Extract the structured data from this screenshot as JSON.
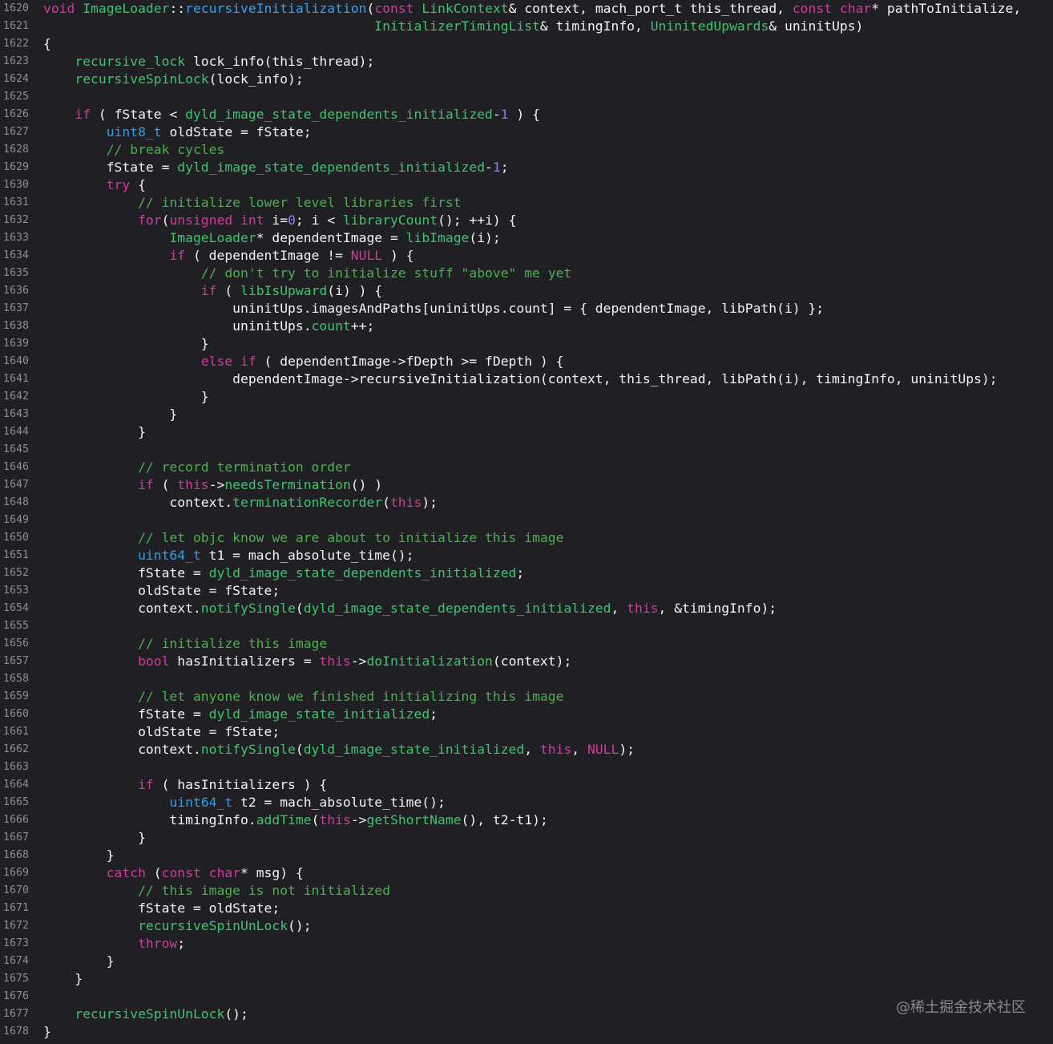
{
  "syntax_colors": {
    "background": "#1f1f24",
    "plain": "#f4f4f4",
    "line_number": "#8d8d93",
    "keyword": "#d3399e",
    "comment": "#49b24a",
    "symbol": "#3fc46e",
    "type": "#2a9ff0",
    "decl": "#35a3ee",
    "number": "#8b80f9",
    "watermark": "#8a8a8a"
  },
  "editor": {
    "lines": [
      {
        "n": 1620,
        "tokens": [
          [
            "keyword",
            "void"
          ],
          " ",
          [
            "symbol",
            "ImageLoader"
          ],
          "::",
          [
            "decl",
            "recursiveInitialization"
          ],
          "(",
          [
            "keyword",
            "const"
          ],
          " ",
          [
            "symbol",
            "LinkContext"
          ],
          "& context, mach_port_t this_thread, ",
          [
            "keyword",
            "const"
          ],
          " ",
          [
            "keyword",
            "char"
          ],
          "* pathToInitialize,"
        ]
      },
      {
        "n": 1621,
        "tokens": [
          "                                          ",
          [
            "symbol",
            "InitializerTimingList"
          ],
          "& timingInfo, ",
          [
            "symbol",
            "UninitedUpwards"
          ],
          "& uninitUps)"
        ]
      },
      {
        "n": 1622,
        "tokens": [
          "{"
        ]
      },
      {
        "n": 1623,
        "tokens": [
          "    ",
          [
            "symbol",
            "recursive_lock"
          ],
          " lock_info(this_thread);"
        ]
      },
      {
        "n": 1624,
        "tokens": [
          "    ",
          [
            "symbol",
            "recursiveSpinLock"
          ],
          "(lock_info);"
        ]
      },
      {
        "n": 1625,
        "tokens": []
      },
      {
        "n": 1626,
        "tokens": [
          "    ",
          [
            "keyword",
            "if"
          ],
          " ( fState < ",
          [
            "symbol",
            "dyld_image_state_dependents_initialized"
          ],
          "-",
          [
            "number",
            "1"
          ],
          " ) {"
        ]
      },
      {
        "n": 1627,
        "tokens": [
          "        ",
          [
            "type",
            "uint8_t"
          ],
          " oldState = fState;"
        ]
      },
      {
        "n": 1628,
        "tokens": [
          "        ",
          [
            "comment",
            "// break cycles"
          ]
        ]
      },
      {
        "n": 1629,
        "tokens": [
          "        fState = ",
          [
            "symbol",
            "dyld_image_state_dependents_initialized"
          ],
          "-",
          [
            "number",
            "1"
          ],
          ";"
        ]
      },
      {
        "n": 1630,
        "tokens": [
          "        ",
          [
            "keyword",
            "try"
          ],
          " {"
        ]
      },
      {
        "n": 1631,
        "tokens": [
          "            ",
          [
            "comment",
            "// initialize lower level libraries first"
          ]
        ]
      },
      {
        "n": 1632,
        "tokens": [
          "            ",
          [
            "keyword",
            "for"
          ],
          "(",
          [
            "keyword",
            "unsigned"
          ],
          " ",
          [
            "keyword",
            "int"
          ],
          " i=",
          [
            "number",
            "0"
          ],
          "; i < ",
          [
            "symbol",
            "libraryCount"
          ],
          "(); ++i) {"
        ]
      },
      {
        "n": 1633,
        "tokens": [
          "                ",
          [
            "symbol",
            "ImageLoader"
          ],
          "* dependentImage = ",
          [
            "symbol",
            "libImage"
          ],
          "(i);"
        ]
      },
      {
        "n": 1634,
        "tokens": [
          "                ",
          [
            "keyword",
            "if"
          ],
          " ( dependentImage != ",
          [
            "keyword",
            "NULL"
          ],
          " ) {"
        ]
      },
      {
        "n": 1635,
        "tokens": [
          "                    ",
          [
            "comment",
            "// don't try to initialize stuff \"above\" me yet"
          ]
        ]
      },
      {
        "n": 1636,
        "tokens": [
          "                    ",
          [
            "keyword",
            "if"
          ],
          " ( ",
          [
            "symbol",
            "libIsUpward"
          ],
          "(i) ) {"
        ]
      },
      {
        "n": 1637,
        "tokens": [
          "                        uninitUps.imagesAndPaths[uninitUps.count] = { dependentImage, libPath(i) };"
        ]
      },
      {
        "n": 1638,
        "tokens": [
          "                        uninitUps.",
          [
            "symbol",
            "count"
          ],
          "++;"
        ]
      },
      {
        "n": 1639,
        "tokens": [
          "                    }"
        ]
      },
      {
        "n": 1640,
        "tokens": [
          "                    ",
          [
            "keyword",
            "else"
          ],
          " ",
          [
            "keyword",
            "if"
          ],
          " ( dependentImage->fDepth >= fDepth ) {"
        ]
      },
      {
        "n": 1641,
        "tokens": [
          "                        dependentImage->recursiveInitialization(context, this_thread, libPath(i), timingInfo, uninitUps);"
        ]
      },
      {
        "n": 1642,
        "tokens": [
          "                    }"
        ]
      },
      {
        "n": 1643,
        "tokens": [
          "                }"
        ]
      },
      {
        "n": 1644,
        "tokens": [
          "            }"
        ]
      },
      {
        "n": 1645,
        "tokens": []
      },
      {
        "n": 1646,
        "tokens": [
          "            ",
          [
            "comment",
            "// record termination order"
          ]
        ]
      },
      {
        "n": 1647,
        "tokens": [
          "            ",
          [
            "keyword",
            "if"
          ],
          " ( ",
          [
            "keyword",
            "this"
          ],
          "->",
          [
            "symbol",
            "needsTermination"
          ],
          "() )"
        ]
      },
      {
        "n": 1648,
        "tokens": [
          "                context.",
          [
            "symbol",
            "terminationRecorder"
          ],
          "(",
          [
            "keyword",
            "this"
          ],
          ");"
        ]
      },
      {
        "n": 1649,
        "tokens": []
      },
      {
        "n": 1650,
        "tokens": [
          "            ",
          [
            "comment",
            "// let objc know we are about to initialize this image"
          ]
        ]
      },
      {
        "n": 1651,
        "tokens": [
          "            ",
          [
            "type",
            "uint64_t"
          ],
          " t1 = mach_absolute_time();"
        ]
      },
      {
        "n": 1652,
        "tokens": [
          "            fState = ",
          [
            "symbol",
            "dyld_image_state_dependents_initialized"
          ],
          ";"
        ]
      },
      {
        "n": 1653,
        "tokens": [
          "            oldState = fState;"
        ]
      },
      {
        "n": 1654,
        "tokens": [
          "            context.",
          [
            "symbol",
            "notifySingle"
          ],
          "(",
          [
            "symbol",
            "dyld_image_state_dependents_initialized"
          ],
          ", ",
          [
            "keyword",
            "this"
          ],
          ", &timingInfo);"
        ]
      },
      {
        "n": 1655,
        "tokens": []
      },
      {
        "n": 1656,
        "tokens": [
          "            ",
          [
            "comment",
            "// initialize this image"
          ]
        ]
      },
      {
        "n": 1657,
        "tokens": [
          "            ",
          [
            "keyword",
            "bool"
          ],
          " hasInitializers = ",
          [
            "keyword",
            "this"
          ],
          "->",
          [
            "symbol",
            "doInitialization"
          ],
          "(context);"
        ]
      },
      {
        "n": 1658,
        "tokens": []
      },
      {
        "n": 1659,
        "tokens": [
          "            ",
          [
            "comment",
            "// let anyone know we finished initializing this image"
          ]
        ]
      },
      {
        "n": 1660,
        "tokens": [
          "            fState = ",
          [
            "symbol",
            "dyld_image_state_initialized"
          ],
          ";"
        ]
      },
      {
        "n": 1661,
        "tokens": [
          "            oldState = fState;"
        ]
      },
      {
        "n": 1662,
        "tokens": [
          "            context.",
          [
            "symbol",
            "notifySingle"
          ],
          "(",
          [
            "symbol",
            "dyld_image_state_initialized"
          ],
          ", ",
          [
            "keyword",
            "this"
          ],
          ", ",
          [
            "keyword",
            "NULL"
          ],
          ");"
        ]
      },
      {
        "n": 1663,
        "tokens": []
      },
      {
        "n": 1664,
        "tokens": [
          "            ",
          [
            "keyword",
            "if"
          ],
          " ( hasInitializers ) {"
        ]
      },
      {
        "n": 1665,
        "tokens": [
          "                ",
          [
            "type",
            "uint64_t"
          ],
          " t2 = mach_absolute_time();"
        ]
      },
      {
        "n": 1666,
        "tokens": [
          "                timingInfo.",
          [
            "symbol",
            "addTime"
          ],
          "(",
          [
            "keyword",
            "this"
          ],
          "->",
          [
            "symbol",
            "getShortName"
          ],
          "(), t2-t1);"
        ]
      },
      {
        "n": 1667,
        "tokens": [
          "            }"
        ]
      },
      {
        "n": 1668,
        "tokens": [
          "        }"
        ]
      },
      {
        "n": 1669,
        "tokens": [
          "        ",
          [
            "keyword",
            "catch"
          ],
          " (",
          [
            "keyword",
            "const"
          ],
          " ",
          [
            "keyword",
            "char"
          ],
          "* msg) {"
        ]
      },
      {
        "n": 1670,
        "tokens": [
          "            ",
          [
            "comment",
            "// this image is not initialized"
          ]
        ]
      },
      {
        "n": 1671,
        "tokens": [
          "            fState = oldState;"
        ]
      },
      {
        "n": 1672,
        "tokens": [
          "            ",
          [
            "symbol",
            "recursiveSpinUnLock"
          ],
          "();"
        ]
      },
      {
        "n": 1673,
        "tokens": [
          "            ",
          [
            "keyword",
            "throw"
          ],
          ";"
        ]
      },
      {
        "n": 1674,
        "tokens": [
          "        }"
        ]
      },
      {
        "n": 1675,
        "tokens": [
          "    }"
        ]
      },
      {
        "n": 1676,
        "tokens": []
      },
      {
        "n": 1677,
        "tokens": [
          "    ",
          [
            "symbol",
            "recursiveSpinUnLock"
          ],
          "();"
        ]
      },
      {
        "n": 1678,
        "tokens": [
          "}"
        ]
      }
    ]
  },
  "watermark": "@稀土掘金技术社区"
}
